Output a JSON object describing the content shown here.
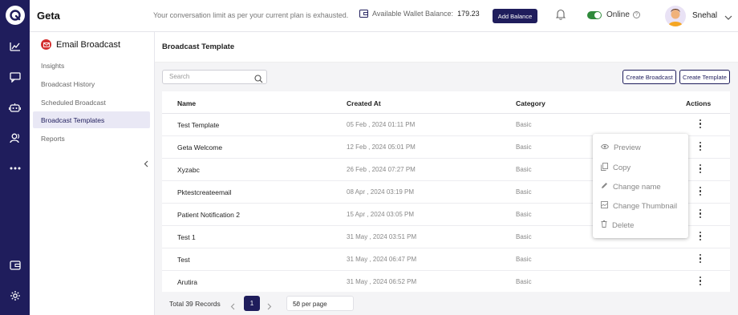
{
  "header": {
    "brand": "Geta",
    "limit_notice": "Your conversation limit as per your current plan is exhausted.",
    "wallet_label": "Available Wallet Balance:",
    "wallet_value": "179.23",
    "add_balance": "Add Balance",
    "status": "Online",
    "user_name": "Snehal"
  },
  "sidebar_icons": [
    "analytics-icon",
    "chat-icon",
    "bot-icon",
    "contacts-icon",
    "more-icon",
    "wallet-icon",
    "settings-icon"
  ],
  "subnav": {
    "title": "Email Broadcast",
    "items": [
      {
        "label": "Insights"
      },
      {
        "label": "Broadcast History"
      },
      {
        "label": "Scheduled Broadcast"
      },
      {
        "label": "Broadcast Templates"
      },
      {
        "label": "Reports"
      }
    ],
    "active_index": 3
  },
  "main": {
    "title": "Broadcast Template",
    "search_placeholder": "Search",
    "create_broadcast": "Create Broadcast",
    "create_template": "Create Template",
    "columns": {
      "name": "Name",
      "created": "Created At",
      "category": "Category",
      "actions": "Actions"
    },
    "rows": [
      {
        "name": "Test Template",
        "created": "05 Feb , 2024 01:11 PM",
        "category": "Basic"
      },
      {
        "name": "Geta Welcome",
        "created": "12 Feb , 2024 05:01 PM",
        "category": "Basic"
      },
      {
        "name": "Xyzabc",
        "created": "26 Feb , 2024 07:27 PM",
        "category": "Basic"
      },
      {
        "name": "Pktestcreateemail",
        "created": "08 Apr , 2024 03:19 PM",
        "category": "Basic"
      },
      {
        "name": "Patient Notification 2",
        "created": "15 Apr , 2024 03:05 PM",
        "category": "Basic"
      },
      {
        "name": "Test 1",
        "created": "31 May , 2024 03:51 PM",
        "category": "Basic"
      },
      {
        "name": "Test",
        "created": "31 May , 2024 06:47 PM",
        "category": "Basic"
      },
      {
        "name": "Arutira",
        "created": "31 May , 2024 06:52 PM",
        "category": "Basic"
      }
    ],
    "footer": {
      "total": "Total 39 Records",
      "page": "1",
      "per_page": "50 per page"
    }
  },
  "context_menu": {
    "items": [
      {
        "label": "Preview",
        "icon": "eye-icon"
      },
      {
        "label": "Copy",
        "icon": "copy-icon"
      },
      {
        "label": "Change name",
        "icon": "pencil-icon"
      },
      {
        "label": "Change Thumbnail",
        "icon": "image-icon"
      },
      {
        "label": "Delete",
        "icon": "trash-icon"
      }
    ]
  },
  "colors": {
    "rail": "#1f1d5c",
    "accent": "#1f1d5c",
    "online": "#2f8a3b",
    "email_badge": "#d32f2f"
  }
}
